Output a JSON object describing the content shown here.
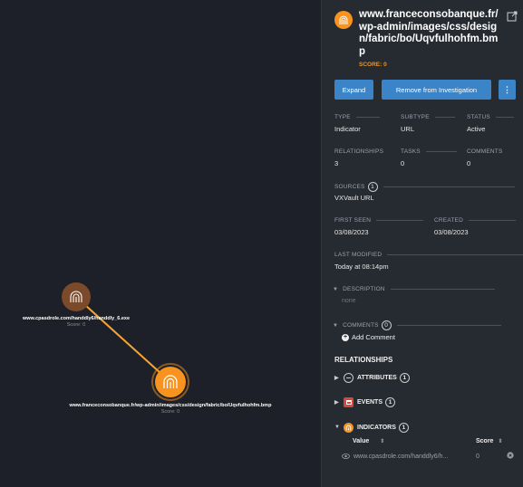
{
  "graph": {
    "nodes": [
      {
        "label": "www.cpasdrole.com/handdly6/handdly_6.exe",
        "score": "Score: 0"
      },
      {
        "label": "www.franceconsobanque.fr/wp-admin/images/css/design/fabric/bo/Uqvfulhohfm.bmp",
        "score": "Score: 0"
      }
    ]
  },
  "panel": {
    "title": "www.franceconsobanque.fr/wp-admin/images/css/design/fabric/bo/Uqvfulhohfm.bmp",
    "score": "SCORE: 0",
    "buttons": {
      "expand": "Expand",
      "remove": "Remove from Investigation",
      "more": "⋮"
    },
    "fields": {
      "type_label": "TYPE",
      "type_value": "Indicator",
      "subtype_label": "SUBTYPE",
      "subtype_value": "URL",
      "status_label": "STATUS",
      "status_value": "Active",
      "relationships_label": "RELATIONSHIPS",
      "relationships_value": "3",
      "tasks_label": "TASKS",
      "tasks_value": "0",
      "comments_label": "COMMENTS",
      "comments_value": "0",
      "sources_label": "SOURCES",
      "sources_count": "1",
      "sources_value": "VXVault URL",
      "first_seen_label": "FIRST SEEN",
      "first_seen_value": "03/08/2023",
      "created_label": "CREATED",
      "created_value": "03/08/2023",
      "last_modified_label": "LAST MODIFIED",
      "last_modified_value": "Today at 08:14pm",
      "description_label": "DESCRIPTION",
      "description_value": "none",
      "comments_section_label": "COMMENTS",
      "comments_section_count": "0",
      "add_comment": "Add Comment"
    },
    "relationships": {
      "heading": "RELATIONSHIPS",
      "attributes": {
        "label": "ATTRIBUTES",
        "count": "1"
      },
      "events": {
        "label": "EVENTS",
        "count": "1"
      },
      "indicators": {
        "label": "INDICATORS",
        "count": "1"
      },
      "table": {
        "col_value": "Value",
        "col_score": "Score",
        "rows": [
          {
            "value": "www.cpasdrole.com/handdly6/h...",
            "score": "0"
          }
        ]
      }
    }
  },
  "colors": {
    "accent_orange": "#f7931e",
    "node_brown": "#7a4a2a",
    "button_blue": "#3a84c7"
  }
}
